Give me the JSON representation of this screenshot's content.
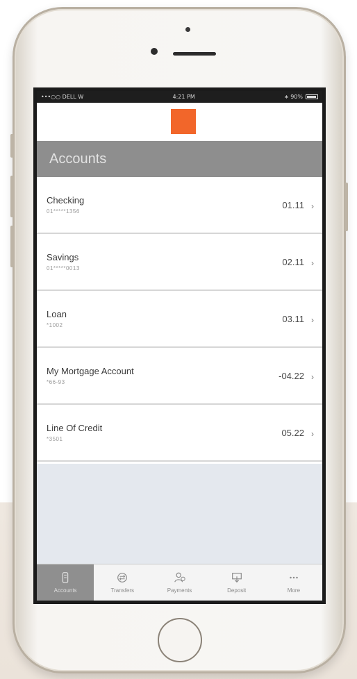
{
  "status_bar": {
    "carrier": "•••○○ DELL W",
    "time": "4:21 PM",
    "battery": "∗ 90%",
    "battery_level": 0.9
  },
  "header": {
    "logo_color": "#f2662a",
    "title": "Accounts"
  },
  "accounts": [
    {
      "name": "Checking",
      "number": "01*****1356",
      "amount": "01.11"
    },
    {
      "name": "Savings",
      "number": "01*****0013",
      "amount": "02.11"
    },
    {
      "name": "Loan",
      "number": "*1002",
      "amount": "03.11"
    },
    {
      "name": "My Mortgage Account",
      "number": "*66-93",
      "amount": "-04.22"
    },
    {
      "name": "Line Of Credit",
      "number": "*3501",
      "amount": "05.22"
    }
  ],
  "tabbar": {
    "items": [
      {
        "label": "Accounts",
        "icon": "accounts-icon",
        "active": true
      },
      {
        "label": "Transfers",
        "icon": "transfers-icon",
        "active": false
      },
      {
        "label": "Payments",
        "icon": "payments-icon",
        "active": false
      },
      {
        "label": "Deposit",
        "icon": "deposit-icon",
        "active": false
      },
      {
        "label": "More",
        "icon": "more-icon",
        "active": false
      }
    ]
  },
  "colors": {
    "accent": "#f2662a",
    "header_bg": "#8e8e8e",
    "tab_active_bg": "#8f8f8f"
  }
}
